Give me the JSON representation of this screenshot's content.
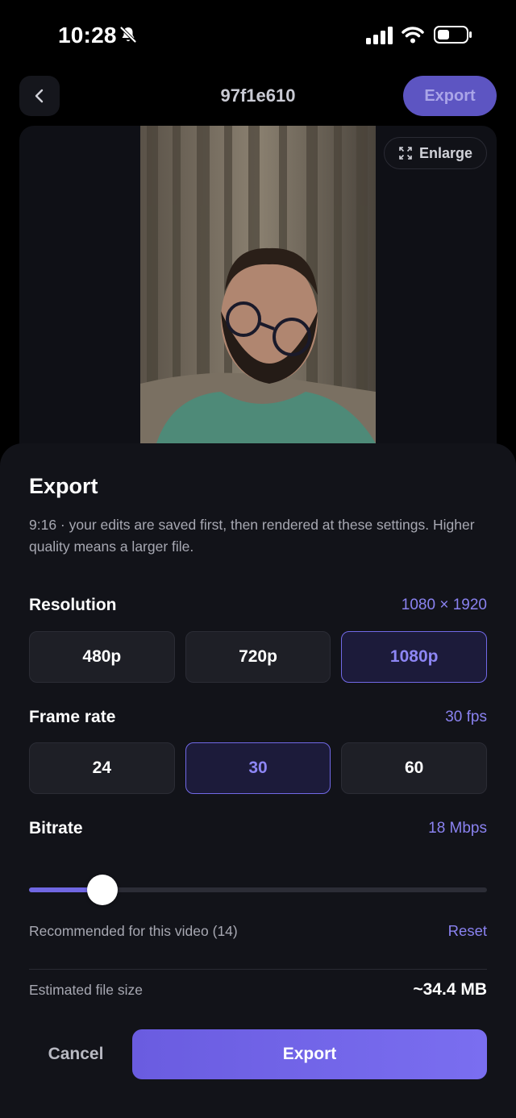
{
  "status_bar": {
    "time": "10:28"
  },
  "header": {
    "title": "97f1e610",
    "export_label": "Export"
  },
  "preview": {
    "enlarge_label": "Enlarge"
  },
  "sheet": {
    "title": "Export",
    "description": "9:16 · your edits are saved first, then rendered at these settings. Higher quality means a larger file.",
    "resolution": {
      "label": "Resolution",
      "value": "1080 × 1920",
      "options": [
        "480p",
        "720p",
        "1080p"
      ],
      "selected": "1080p"
    },
    "frame_rate": {
      "label": "Frame rate",
      "value": "30 fps",
      "options": [
        "24",
        "30",
        "60"
      ],
      "selected": "30"
    },
    "bitrate": {
      "label": "Bitrate",
      "value": "18 Mbps",
      "slider_fraction": 0.16,
      "recommended": "Recommended for this video (14)",
      "reset_label": "Reset"
    },
    "estimate": {
      "label": "Estimated file size",
      "value": "~34.4 MB"
    },
    "cancel_label": "Cancel",
    "export_label": "Export"
  },
  "colors": {
    "accent": "#7067e2",
    "background": "#121319"
  }
}
